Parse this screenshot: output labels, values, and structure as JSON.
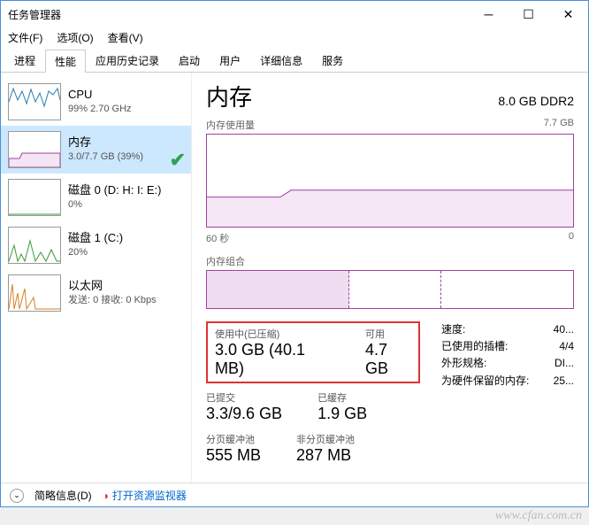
{
  "titlebar": {
    "title": "任务管理器"
  },
  "menubar": {
    "file": "文件(F)",
    "options": "选项(O)",
    "view": "查看(V)"
  },
  "tabs": {
    "processes": "进程",
    "performance": "性能",
    "apphistory": "应用历史记录",
    "startup": "启动",
    "users": "用户",
    "details": "详细信息",
    "services": "服务"
  },
  "sidebar": {
    "cpu": {
      "title": "CPU",
      "sub": "99%  2.70 GHz"
    },
    "memory": {
      "title": "内存",
      "sub": "3.0/7.7 GB (39%)"
    },
    "disk0": {
      "title": "磁盘 0 (D: H: I: E:)",
      "sub": "0%"
    },
    "disk1": {
      "title": "磁盘 1 (C:)",
      "sub": "20%"
    },
    "ethernet": {
      "title": "以太网",
      "sub": "发送: 0  接收: 0 Kbps"
    }
  },
  "main": {
    "title": "内存",
    "total": "8.0 GB DDR2",
    "usage_label": "内存使用量",
    "usage_max": "7.7 GB",
    "x_left": "60 秒",
    "x_right": "0",
    "compo_label": "内存组合",
    "inuse_label": "使用中(已压缩)",
    "inuse_value": "3.0 GB (40.1 MB)",
    "avail_label": "可用",
    "avail_value": "4.7 GB",
    "committed_label": "已提交",
    "committed_value": "3.3/9.6 GB",
    "cached_label": "已缓存",
    "cached_value": "1.9 GB",
    "paged_label": "分页缓冲池",
    "paged_value": "555 MB",
    "nonpaged_label": "非分页缓冲池",
    "nonpaged_value": "287 MB",
    "speed_label": "速度:",
    "speed_value": "40...",
    "slots_label": "已使用的插槽:",
    "slots_value": "4/4",
    "form_label": "外形规格:",
    "form_value": "DI...",
    "reserved_label": "为硬件保留的内存:",
    "reserved_value": "25..."
  },
  "footer": {
    "brief": "简略信息(D)",
    "monitor": "打开资源监视器"
  },
  "watermark": "www.cfan.com.cn",
  "chart_data": {
    "type": "line",
    "title": "内存使用量",
    "ylabel": "GB",
    "ylim": [
      0,
      7.7
    ],
    "xlabel": "秒",
    "xrange": [
      60,
      0
    ],
    "series": [
      {
        "name": "内存",
        "values": [
          2.6,
          2.6,
          2.6,
          2.6,
          3.0,
          3.0,
          3.0,
          3.0,
          3.0,
          3.0,
          3.0,
          3.0,
          3.0,
          3.0,
          3.0,
          3.0,
          3.0,
          3.0,
          3.0,
          3.0
        ]
      }
    ],
    "composition": {
      "in_use_gb": 3.0,
      "cached_gb": 1.9,
      "total_gb": 7.7
    }
  }
}
